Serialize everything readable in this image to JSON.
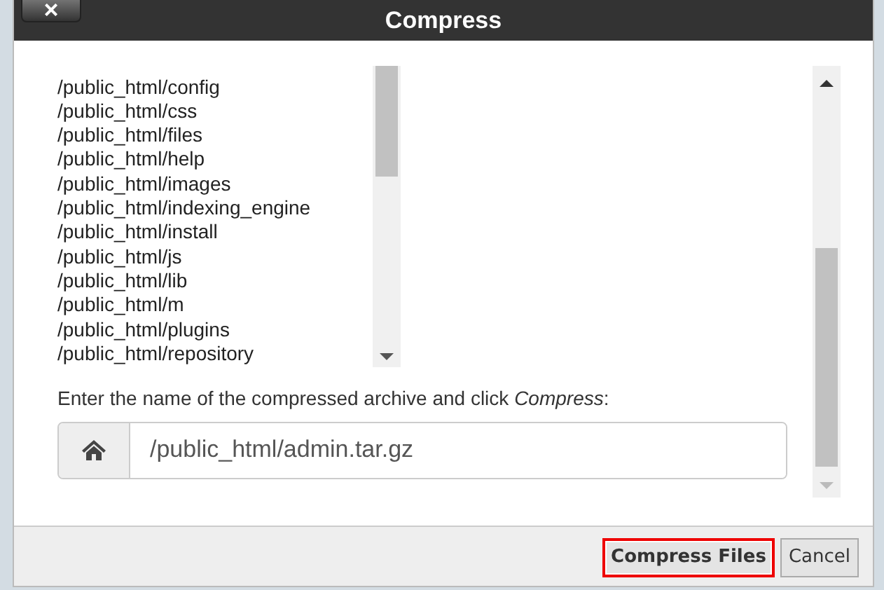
{
  "dialog": {
    "title": "Compress",
    "close_label": "×"
  },
  "folders": [
    "/public_html/config",
    "/public_html/css",
    "/public_html/files",
    "/public_html/help",
    "/public_html/images",
    "/public_html/indexing_engine",
    "/public_html/install",
    "/public_html/js",
    "/public_html/lib",
    "/public_html/m",
    "/public_html/plugins",
    "/public_html/repository"
  ],
  "prompt": "Enter the name of the compressed archive and click *Compress*:",
  "archive_field": {
    "value": "/public_html/admin.tar.gz"
  },
  "buttons": [
    {
      "label": "Compress Files",
      "focused": true
    },
    {
      "label": "Cancel",
      "focused": false
    }
  ]
}
